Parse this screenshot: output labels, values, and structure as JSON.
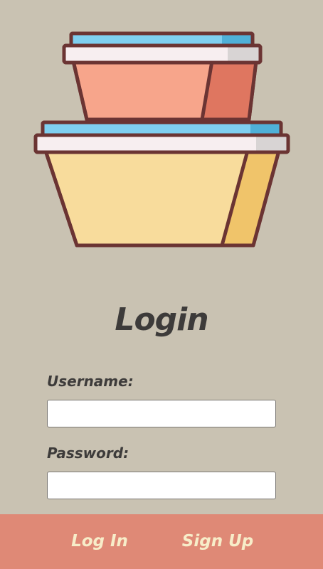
{
  "header": {
    "title": "Login",
    "illustration_icon": "stacked-food-containers-icon"
  },
  "form": {
    "username_label": "Username:",
    "username_value": "",
    "username_placeholder": "",
    "password_label": "Password:",
    "password_value": "",
    "password_placeholder": ""
  },
  "footer": {
    "login_label": "Log In",
    "signup_label": "Sign Up"
  },
  "colors": {
    "background": "#c9c2b2",
    "accent_bar": "#df8976",
    "bar_text": "#f7edc9",
    "text": "#3d3b3a"
  }
}
